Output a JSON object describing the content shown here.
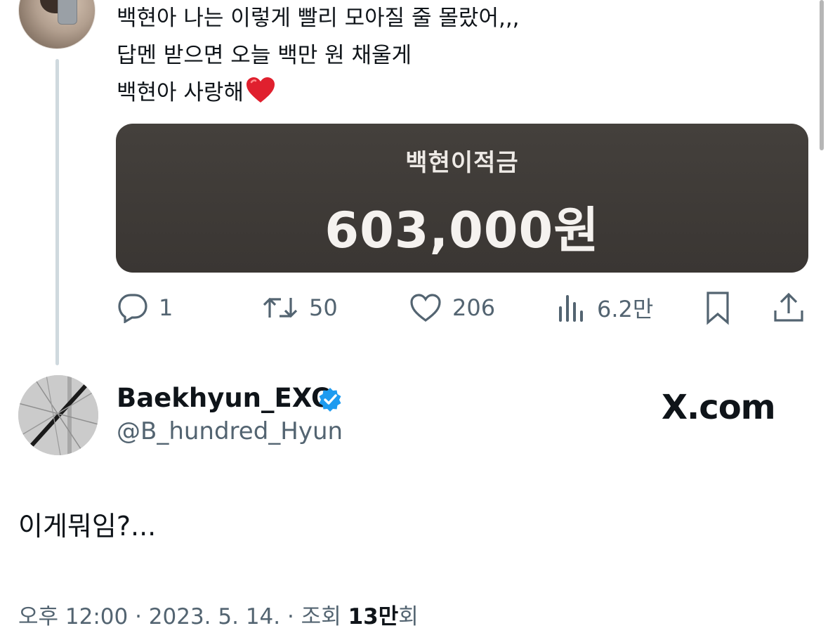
{
  "tweet": {
    "lines": [
      "백현아 나는 이렇게 빨리 모아질 줄 몰랐어,,,",
      "답멘 받으면 오늘 백만 원 채울게",
      "백현아 사랑해"
    ],
    "emoji": "red-heart",
    "card": {
      "title": "백현이적금",
      "amount": "603,000원"
    },
    "actions": {
      "reply_count": "1",
      "retweet_count": "50",
      "like_count": "206",
      "views_count": "6.2만"
    }
  },
  "reply_author": {
    "display_name": "Baekhyun_EXO",
    "handle": "@B_hundred_Hyun",
    "verified": true,
    "badge_color": "#1d9bf0"
  },
  "watermark": "X.com",
  "reply_tweet": {
    "text": "이게뭐임?...",
    "meta_prefix": "오후 12:00 · 2023. 5. 14. · 조회 ",
    "views_number": "13만",
    "views_suffix": "회"
  },
  "colors": {
    "text_primary": "#0f1419",
    "text_secondary": "#536471",
    "card_background": "#3f3b38",
    "thread_line": "#cfd9de"
  }
}
